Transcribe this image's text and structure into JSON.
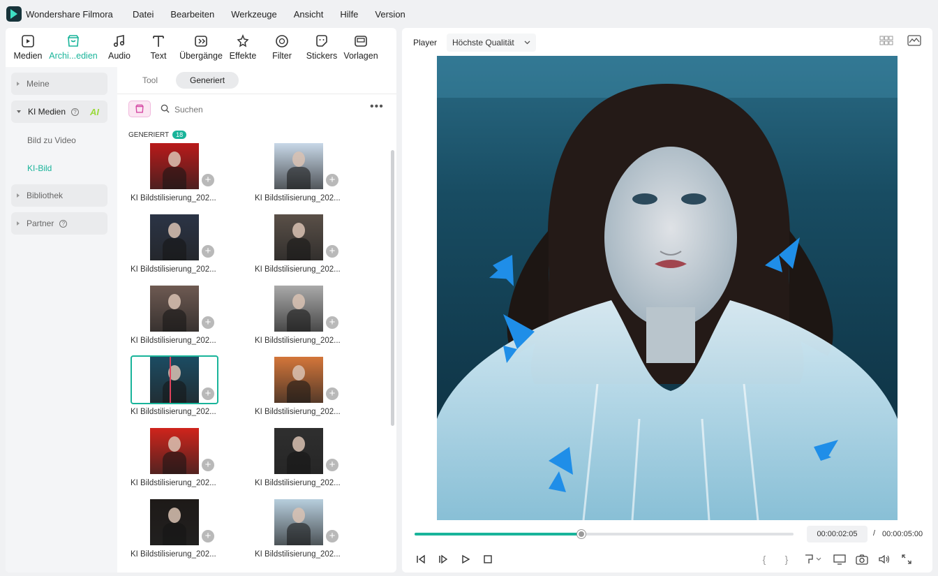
{
  "app": {
    "title": "Wondershare Filmora"
  },
  "menu": [
    "Datei",
    "Bearbeiten",
    "Werkzeuge",
    "Ansicht",
    "Hilfe",
    "Version"
  ],
  "toolbar": [
    {
      "label": "Medien",
      "icon": "media-icon"
    },
    {
      "label": "Archi...edien",
      "icon": "archive-media-icon",
      "active": true
    },
    {
      "label": "Audio",
      "icon": "music-note-icon"
    },
    {
      "label": "Text",
      "icon": "text-icon"
    },
    {
      "label": "Übergänge",
      "icon": "transition-icon"
    },
    {
      "label": "Effekte",
      "icon": "effects-icon"
    },
    {
      "label": "Filter",
      "icon": "filter-icon"
    },
    {
      "label": "Stickers",
      "icon": "sticker-icon"
    },
    {
      "label": "Vorlagen",
      "icon": "template-icon"
    }
  ],
  "sidebar": {
    "meine": "Meine",
    "ki_medien": "KI Medien",
    "ai_badge": "AI",
    "sub_items": [
      "Bild zu Video",
      "KI-Bild"
    ],
    "bibliothek": "Bibliothek",
    "partner": "Partner"
  },
  "tabs": [
    "Tool",
    "Generiert"
  ],
  "search": {
    "placeholder": "Suchen"
  },
  "generated": {
    "label": "GENERIERT",
    "count": "18"
  },
  "items": [
    {
      "name": "KI Bildstilisierung_202...",
      "bg": "#b91a1a"
    },
    {
      "name": "KI Bildstilisierung_202...",
      "bg": "#c8d8e8"
    },
    {
      "name": "KI Bildstilisierung_202...",
      "bg": "#2b3446"
    },
    {
      "name": "KI Bildstilisierung_202...",
      "bg": "#5a5048"
    },
    {
      "name": "KI Bildstilisierung_202...",
      "bg": "#6e5a52"
    },
    {
      "name": "KI Bildstilisierung_202...",
      "bg": "#a9a9a9"
    },
    {
      "name": "KI Bildstilisierung_202...",
      "bg": "#1c4c63",
      "selected": true
    },
    {
      "name": "KI Bildstilisierung_202...",
      "bg": "#d4763a"
    },
    {
      "name": "KI Bildstilisierung_202...",
      "bg": "#d0241c"
    },
    {
      "name": "KI Bildstilisierung_202...",
      "bg": "#2f2f2f"
    },
    {
      "name": "KI Bildstilisierung_202...",
      "bg": "#1e1a18"
    },
    {
      "name": "KI Bildstilisierung_202...",
      "bg": "#b7cedd"
    }
  ],
  "player": {
    "label": "Player",
    "quality": "Höchste Qualität",
    "time_current": "00:00:02:05",
    "time_separator": "/",
    "time_total": "00:00:05:00",
    "progress": 0.44
  },
  "colors": {
    "accent": "#19b49a",
    "ai_badge": "#9ad93b"
  }
}
